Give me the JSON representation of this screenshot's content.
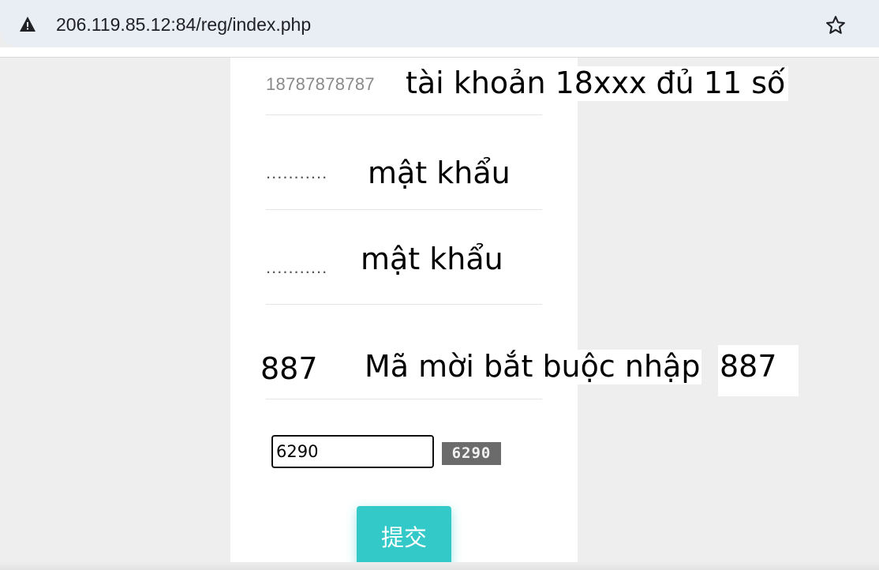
{
  "browser": {
    "url": "206.119.85.12:84/reg/index.php",
    "security_icon": "warning-triangle-icon",
    "bookmark_icon": "star-icon"
  },
  "form": {
    "account": {
      "value": "18787878787",
      "note": "tài khoản 18xxx đủ 11 số"
    },
    "password": {
      "value": "...........",
      "note": "mật khẩu"
    },
    "confirm_password": {
      "value": "...........",
      "note": "mật khẩu"
    },
    "invite_code": {
      "value": "887",
      "note": "Mã mời bắt buộc nhập",
      "note_value": "887"
    },
    "captcha": {
      "value": "6290",
      "image_text": "6290"
    },
    "submit_label": "提交"
  },
  "colors": {
    "accent": "#33c9c9",
    "page_bg": "#eeeeee",
    "panel_bg": "#ffffff"
  }
}
